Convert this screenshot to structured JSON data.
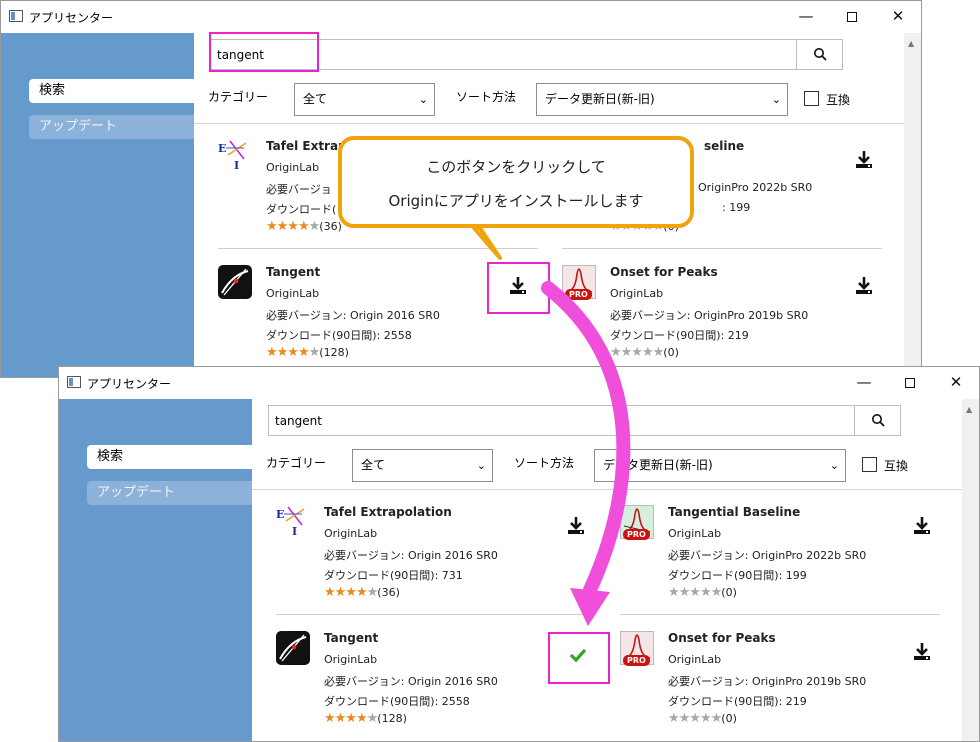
{
  "window": {
    "title": "アプリセンター",
    "minimize_label": "—",
    "close_label": "✕"
  },
  "sidebar": {
    "items": [
      {
        "label": "検索"
      },
      {
        "label": "アップデート"
      }
    ]
  },
  "search": {
    "value": "tangent",
    "button_icon": "search-icon"
  },
  "filters": {
    "category_label": "カテゴリー",
    "category_value": "全て",
    "sort_label": "ソート方法",
    "sort_value": "データ更新日(新-旧)",
    "compat_label": "互換"
  },
  "apps": [
    {
      "name": "Tafel Extrapolation",
      "publisher": "OriginLab",
      "requirement": "必要バージョン: Origin 2016 SR0",
      "downloads": "ダウンロード(90日間): 731",
      "rating": 4,
      "reviews": "(36)",
      "icon": "tafel-logo-icon"
    },
    {
      "name": "Tangential Baseline",
      "publisher": "OriginLab",
      "requirement": "必要バージョン: OriginPro 2022b SR0",
      "downloads": "ダウンロード(90日間): 199",
      "rating": 0,
      "reviews": "(0)",
      "icon": "peak-pro-logo-icon"
    },
    {
      "name": "Tangent",
      "publisher": "OriginLab",
      "requirement": "必要バージョン: Origin 2016 SR0",
      "downloads": "ダウンロード(90日間): 2558",
      "rating": 4,
      "reviews": "(128)",
      "icon": "tangent-logo-icon"
    },
    {
      "name": "Onset for Peaks",
      "publisher": "OriginLab",
      "requirement": "必要バージョン: OriginPro 2019b SR0",
      "downloads": "ダウンロード(90日間): 219",
      "rating": 0,
      "reviews": "(0)",
      "icon": "peak-pro-logo-icon"
    }
  ],
  "top_window_visible": {
    "tafel_name_partial": "Tafel Extrap",
    "tafel_req_partial": "必要バージョ",
    "tafel_dl_partial": "ダウンロード(",
    "tafel_reviews_partial": "(36)",
    "tangential_name_partial": "seline",
    "tangential_req_partial": "OriginPro 2022b SR0",
    "tangential_dl_partial": ": 199",
    "tangential_reviews_partial": "(0)"
  },
  "pro_badge": "PRO",
  "callout": {
    "line1": "このボタンをクリックして",
    "line2": "Originにアプリをインストールします"
  },
  "colors": {
    "sidebar": "#6699cc",
    "highlight": "#ee22cc",
    "callout_border": "#f0a30a",
    "star_on": "#e9891f",
    "check": "#3ba02c"
  }
}
